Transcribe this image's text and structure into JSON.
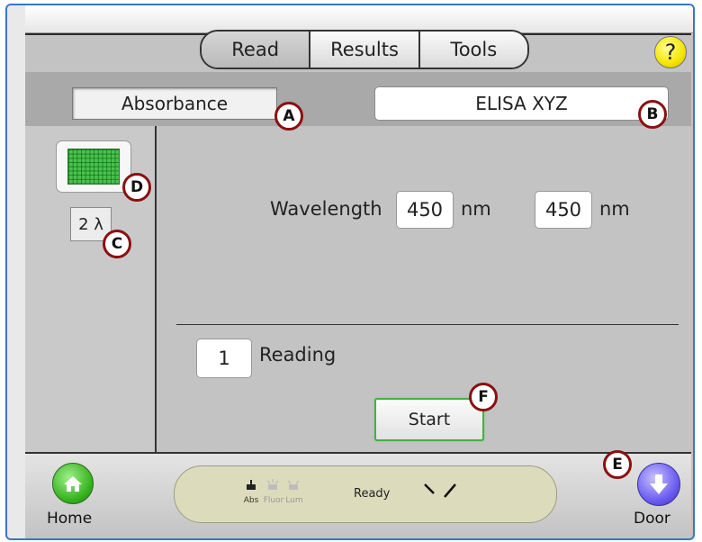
{
  "tabs": {
    "read": "Read",
    "results": "Results",
    "tools": "Tools"
  },
  "help_label": "?",
  "read_mode": "Absorbance",
  "protocol_name": "ELISA XYZ",
  "wavelength_count": "2 λ",
  "wavelength": {
    "label": "Wavelength",
    "value1": "450",
    "unit1": "nm",
    "value2": "450",
    "unit2": "nm"
  },
  "reading": {
    "count": "1",
    "label": "Reading"
  },
  "start_label": "Start",
  "home_label": "Home",
  "door_label": "Door",
  "status": {
    "modes": [
      "Abs",
      "Fluor",
      "Lum"
    ],
    "text": "Ready"
  },
  "markers": {
    "a": "A",
    "b": "B",
    "c": "C",
    "d": "D",
    "e": "E",
    "f": "F"
  },
  "colors": {
    "frame": "#3a76c4",
    "start_border": "#45b045",
    "marker_border": "#8b1010",
    "help": "#f5e400",
    "home": "#35b21d",
    "door": "#6d5ff0"
  }
}
